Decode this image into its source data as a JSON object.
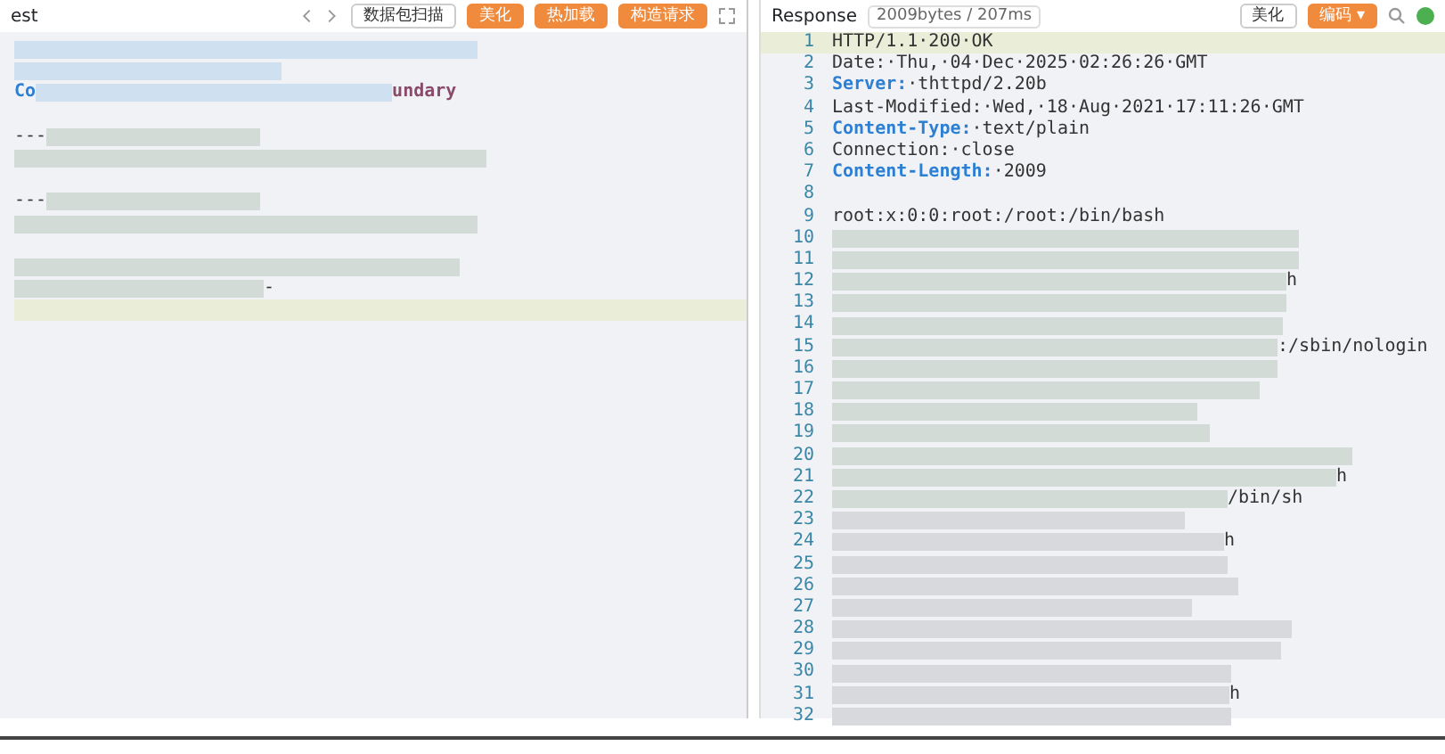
{
  "request": {
    "title": "est",
    "buttons": [
      {
        "label": "数据包扫描",
        "kind": "outline"
      },
      {
        "label": "美化",
        "kind": "primary"
      },
      {
        "label": "热加载",
        "kind": "primary"
      },
      {
        "label": "构造请求",
        "kind": "primary"
      }
    ],
    "lines": [
      {
        "kind": "redacted",
        "highlighted": false
      },
      {
        "kind": "redacted",
        "highlighted": false
      },
      {
        "kind": "header",
        "prefix": "Co",
        "suffix": "undary",
        "highlighted": false
      },
      {
        "kind": "blank",
        "highlighted": false
      },
      {
        "kind": "plain",
        "prefix": "---",
        "highlighted": false
      },
      {
        "kind": "redacted",
        "highlighted": false
      },
      {
        "kind": "blank",
        "highlighted": false
      },
      {
        "kind": "plain",
        "prefix": "---",
        "highlighted": false
      },
      {
        "kind": "redacted",
        "highlighted": false
      },
      {
        "kind": "blank",
        "highlighted": false
      },
      {
        "kind": "redacted",
        "highlighted": false
      },
      {
        "kind": "plain",
        "suffix": "-",
        "highlighted": false
      },
      {
        "kind": "blank",
        "highlighted": true
      }
    ]
  },
  "response": {
    "title": "Response",
    "meta": "2009bytes / 207ms",
    "buttons": [
      {
        "label": "美化",
        "kind": "outline"
      },
      {
        "label": "编码 ▾",
        "kind": "primary"
      }
    ],
    "lines": [
      {
        "num": "1",
        "kind": "plain",
        "text": "HTTP/1.1·200·OK",
        "highlighted": true
      },
      {
        "num": "2",
        "kind": "plain",
        "text": "Date:·Thu,·04·Dec·2025·02:26:26·GMT",
        "highlighted": false
      },
      {
        "num": "3",
        "kind": "header",
        "key": "Server:",
        "text": "·thttpd/2.20b",
        "highlighted": false
      },
      {
        "num": "4",
        "kind": "plain",
        "text": "Last-Modified:·Wed,·18·Aug·2021·17:11:26·GMT",
        "highlighted": false
      },
      {
        "num": "5",
        "kind": "header",
        "key": "Content-Type:",
        "text": "·text/plain",
        "highlighted": false
      },
      {
        "num": "6",
        "kind": "plain",
        "text": "Connection:·close",
        "highlighted": false
      },
      {
        "num": "7",
        "kind": "header",
        "key": "Content-Length:",
        "text": "·2009",
        "highlighted": false
      },
      {
        "num": "8",
        "kind": "blank",
        "highlighted": false
      },
      {
        "num": "9",
        "kind": "plain",
        "text": "root:x:0:0:root:/root:/bin/bash",
        "highlighted": false
      },
      {
        "num": "10",
        "kind": "redacted",
        "highlighted": false
      },
      {
        "num": "11",
        "kind": "redacted",
        "highlighted": false
      },
      {
        "num": "12",
        "kind": "redacted",
        "text": "h",
        "highlighted": false
      },
      {
        "num": "13",
        "kind": "redacted",
        "highlighted": false
      },
      {
        "num": "14",
        "kind": "redacted",
        "highlighted": false
      },
      {
        "num": "15",
        "kind": "redacted",
        "text": ":/sbin/nologin",
        "highlighted": false
      },
      {
        "num": "16",
        "kind": "redacted",
        "highlighted": false
      },
      {
        "num": "17",
        "kind": "redacted",
        "highlighted": false
      },
      {
        "num": "18",
        "kind": "redacted",
        "highlighted": false
      },
      {
        "num": "19",
        "kind": "redacted",
        "highlighted": false
      },
      {
        "num": "20",
        "kind": "redacted",
        "highlighted": false
      },
      {
        "num": "21",
        "kind": "redacted",
        "text": "h",
        "highlighted": false
      },
      {
        "num": "22",
        "kind": "redacted",
        "text": "/bin/sh",
        "highlighted": false
      },
      {
        "num": "23",
        "kind": "redacted",
        "highlighted": false
      },
      {
        "num": "24",
        "kind": "redacted",
        "text": "h",
        "highlighted": false
      },
      {
        "num": "25",
        "kind": "redacted",
        "highlighted": false
      },
      {
        "num": "26",
        "kind": "redacted",
        "highlighted": false
      },
      {
        "num": "27",
        "kind": "redacted",
        "highlighted": false
      },
      {
        "num": "28",
        "kind": "redacted",
        "highlighted": false
      },
      {
        "num": "29",
        "kind": "redacted",
        "highlighted": false
      },
      {
        "num": "30",
        "kind": "redacted",
        "highlighted": false
      },
      {
        "num": "31",
        "kind": "redacted",
        "text": "h",
        "highlighted": false
      },
      {
        "num": "32",
        "kind": "redacted",
        "highlighted": false
      }
    ]
  }
}
